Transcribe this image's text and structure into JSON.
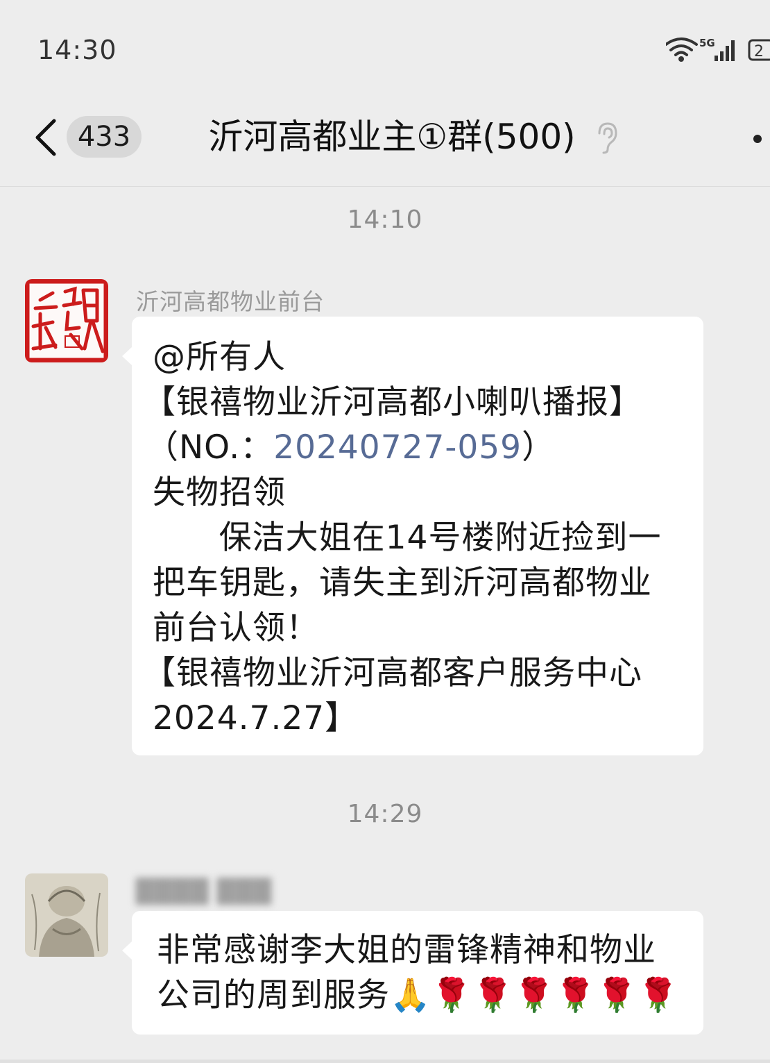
{
  "status_bar": {
    "time": "14:30",
    "network": "5G",
    "battery_digit": "2"
  },
  "header": {
    "unread_count": "433",
    "title": "沂河高都业主①群(500)"
  },
  "messages": [
    {
      "timestamp": "14:10",
      "sender": "沂河高都物业前台",
      "lines": [
        "@所有人",
        "【银禧物业沂河高都小喇叭播报】",
        "（NO.：",
        "20240727-059",
        "）",
        "失物招领",
        "      保洁大姐在14号楼附近捡到一",
        "把车钥匙，请失主到沂河高都物业",
        "前台认领！",
        "【银禧物业沂河高都客户服务中心",
        "2024.7.27】"
      ]
    },
    {
      "timestamp": "14:29",
      "sender": "████ ███",
      "lines": [
        "非常感谢李大姐的雷锋精神和物业",
        "公司的周到服务🙏🌹🌹🌹🌹🌹🌹"
      ]
    }
  ],
  "colors": {
    "background": "#ededed",
    "bubble": "#ffffff",
    "link": "#576b95",
    "seal_red": "#cc1c1c"
  }
}
